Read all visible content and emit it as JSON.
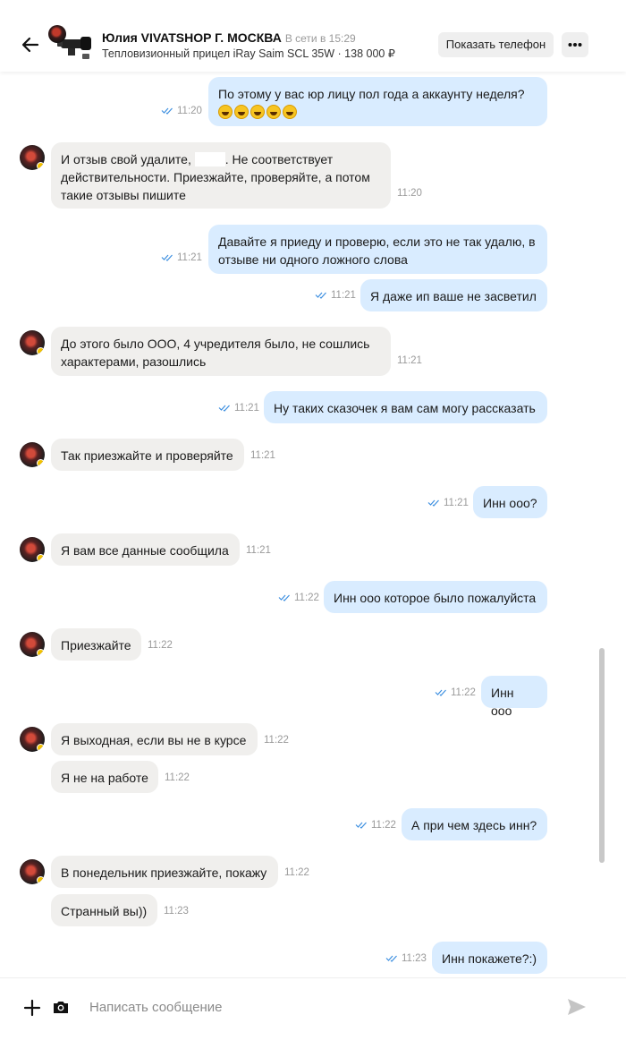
{
  "header": {
    "name": "Юлия VIVATSHOP Г. МОСКВА",
    "status": "В сети в 15:29",
    "listing": "Тепловизионный прицел iRay Saim SCL 35W · 138 000 ₽",
    "phone_button": "Показать телефон"
  },
  "messages": [
    {
      "dir": "out",
      "lines": [
        "По этому у вас юр лицу пол года а аккаунту неделя?"
      ],
      "emoji_count": 5,
      "time": "11:20"
    },
    {
      "dir": "in",
      "lines": [
        "И отзыв свой удалите, ",
        ". Не соответствует",
        "действительности. Приезжайте, проверяйте, а потом",
        "такие отзывы пишите"
      ],
      "time": "11:20"
    },
    {
      "dir": "out",
      "lines": [
        "Давайте я приеду и проверю, если это не так удалю, в",
        "отзыве ни одного ложного слова"
      ],
      "time": "11:21"
    },
    {
      "dir": "out",
      "lines": [
        "Я даже ип ваше не засветил"
      ],
      "time": "11:21"
    },
    {
      "dir": "in",
      "lines": [
        "До этого было ООО, 4 учредителя было, не сошлись",
        "характерами, разошлись"
      ],
      "time": "11:21"
    },
    {
      "dir": "out",
      "lines": [
        "Ну таких сказочек я вам сам могу рассказать"
      ],
      "time": "11:21"
    },
    {
      "dir": "in",
      "lines": [
        "Так приезжайте и проверяйте"
      ],
      "time": "11:21"
    },
    {
      "dir": "out",
      "lines": [
        "Инн ооо?"
      ],
      "time": "11:21"
    },
    {
      "dir": "in",
      "lines": [
        "Я вам все данные сообщила"
      ],
      "time": "11:21"
    },
    {
      "dir": "out",
      "lines": [
        "Инн ооо которое было пожалуйста"
      ],
      "time": "11:22"
    },
    {
      "dir": "in",
      "lines": [
        "Приезжайте"
      ],
      "time": "11:22"
    },
    {
      "dir": "out",
      "lines": [
        "Инн ооо"
      ],
      "time": "11:22"
    },
    {
      "dir": "in",
      "lines": [
        "Я выходная, если вы не в курсе"
      ],
      "time": "11:22"
    },
    {
      "dir": "in",
      "lines": [
        "Я не на работе"
      ],
      "time": "11:22"
    },
    {
      "dir": "out",
      "lines": [
        "А при чем здесь инн?"
      ],
      "time": "11:22"
    },
    {
      "dir": "in",
      "lines": [
        "В понедельник приезжайте, покажу"
      ],
      "time": "11:22"
    },
    {
      "dir": "in",
      "lines": [
        "Странный вы))"
      ],
      "time": "11:23"
    },
    {
      "dir": "out",
      "lines": [
        "Инн покажете?:)"
      ],
      "time": "11:23"
    }
  ],
  "composer": {
    "placeholder": "Написать сообщение"
  },
  "colors": {
    "outgoing_bubble": "#d9ecff",
    "incoming_bubble": "#f0efed",
    "read_check": "#3d8fe0"
  }
}
